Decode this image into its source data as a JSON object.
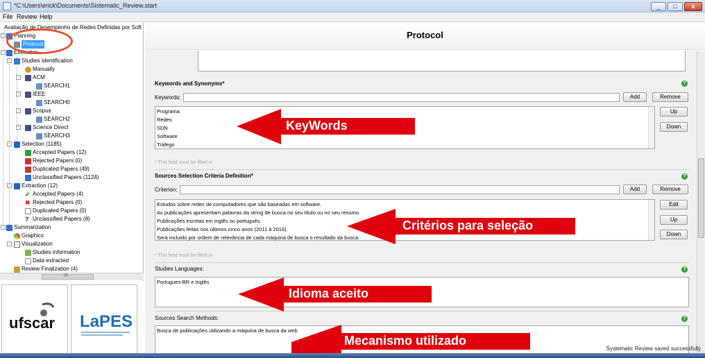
{
  "window": {
    "title": "*C:\\Users\\erick\\Documents\\Sistematic_Review.start",
    "min": "_",
    "max": "□",
    "close": "x"
  },
  "menu": [
    "File",
    "Review",
    "Help"
  ],
  "tree": {
    "root": "Avaliação de Desempenho de Redes Definidas por Soft",
    "planning": "Planning",
    "protocol": "Protocol",
    "execution": "Execution",
    "studies_identification": "Studies Identification",
    "manually": "Manually",
    "acm": "ACM",
    "search1": "SEARCH1",
    "ieee": "IEEE",
    "search0": "SEARCH0",
    "scopus": "Scopus",
    "search2": "SEARCH2",
    "science_direct": "Science Direct",
    "search3": "SEARCH3",
    "selection": "Selection (1185)",
    "sel_accepted": "Accepted Papers (12)",
    "sel_rejected": "Rejected Papers (0)",
    "sel_duplicated": "Duplicated Papers (49)",
    "sel_unclassified": "Unclassified Papers (1124)",
    "extraction": "Extraction (12)",
    "ext_accepted": "Accepted Papers (4)",
    "ext_rejected": "Rejected Papers (0)",
    "ext_duplicated": "Duplicated Papers (0)",
    "ext_unclassified": "Unclassified Papers (8)",
    "summarization": "Summarization",
    "graphics": "Graphics",
    "visualization": "Visualization",
    "studies_information": "Studies information",
    "data_extracted": "Data extracted",
    "review_finalization": "Review Finalization (4)"
  },
  "scroll_glyph": "III",
  "logos": {
    "left": "ufscar",
    "right": "LaPES"
  },
  "header": {
    "title": "Protocol"
  },
  "keywords": {
    "section": "Keywords and Synonyms*",
    "label": "Keywords:",
    "add": "Add",
    "remove": "Remove",
    "up": "Up",
    "down": "Down",
    "items": [
      "Programa",
      "Redes",
      "SDN",
      "Software",
      "Tráfego"
    ],
    "note": "* This field must be filled in"
  },
  "criteria": {
    "section": "Sources Selection Criteria Definition*",
    "label": "Criterion:",
    "add": "Add",
    "remove": "Remove",
    "edit": "Edit",
    "up": "Up",
    "down": "Down",
    "items": [
      "Estudos sobre redes de computadores que são baseadas em software.",
      "As publicações apresentam palavras da string de busca no seu título ou no seu resumo.",
      "Publicações escritas em inglês ou português.",
      "Publicações feitas nos últimos cinco anos (2011 à 2016).",
      "Será incluido por ordem de relevância de cada máquina de busca o resultado da busca."
    ],
    "note": "* This field must be filled in"
  },
  "languages": {
    "label": "Studies Languages:",
    "value": "Portugues-BR e Inglês"
  },
  "methods": {
    "label": "Sources Search Methods:",
    "value": "Busca de publicações utilizando a máquina de busca da web"
  },
  "annotations": {
    "a1": "KeyWords",
    "a2": "Critérios para seleção",
    "a3": "Idioma aceito",
    "a4": "Mecanismo utilizado"
  },
  "status": "Systematic Review saved successfully",
  "colors": {
    "arrow": "#e0000d",
    "circle": "#e8502a",
    "selection": "#3399ff"
  }
}
